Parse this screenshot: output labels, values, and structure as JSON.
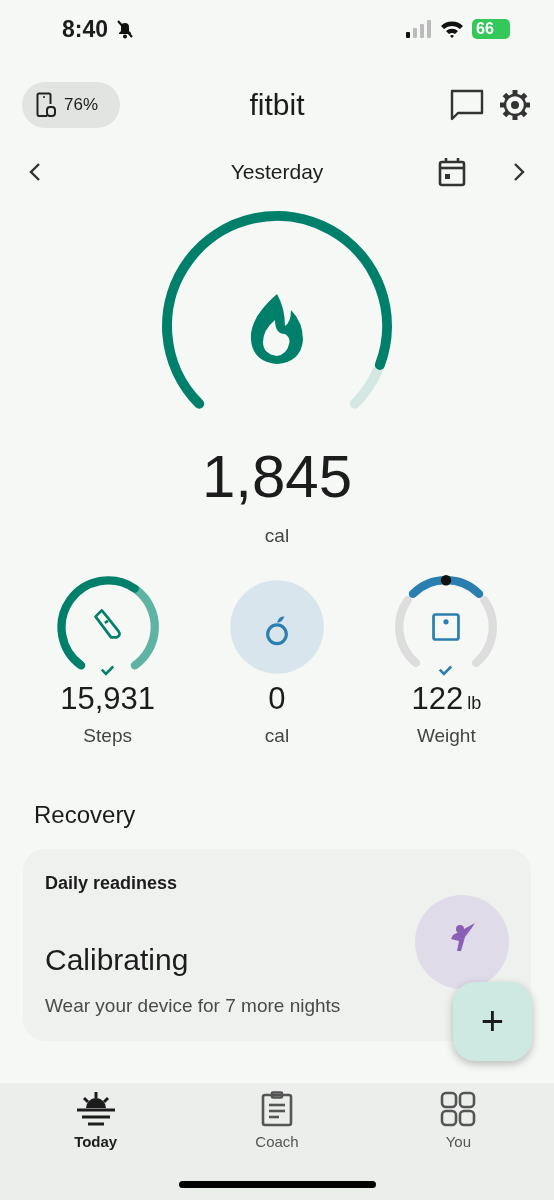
{
  "status_bar": {
    "time": "8:40",
    "battery": "66"
  },
  "header": {
    "device_battery": "76%",
    "logo": "fitbit"
  },
  "date_nav": {
    "label": "Yesterday"
  },
  "calories": {
    "value": "1,845",
    "unit": "cal"
  },
  "metrics": [
    {
      "kind": "steps",
      "goal_met": true,
      "value": "15,931",
      "label": "Steps"
    },
    {
      "kind": "food",
      "value": "0",
      "label": "cal"
    },
    {
      "kind": "weight",
      "goal_met": true,
      "value": "122",
      "unit": "lb",
      "label": "Weight"
    }
  ],
  "recovery": {
    "heading": "Recovery",
    "card": {
      "title": "Daily readiness",
      "status": "Calibrating",
      "note": "Wear your device for 7 more nights"
    }
  },
  "fab": {
    "label": "+"
  },
  "nav": [
    {
      "label": "Today",
      "selected": true
    },
    {
      "label": "Coach",
      "selected": false
    },
    {
      "label": "You",
      "selected": false
    }
  ]
}
